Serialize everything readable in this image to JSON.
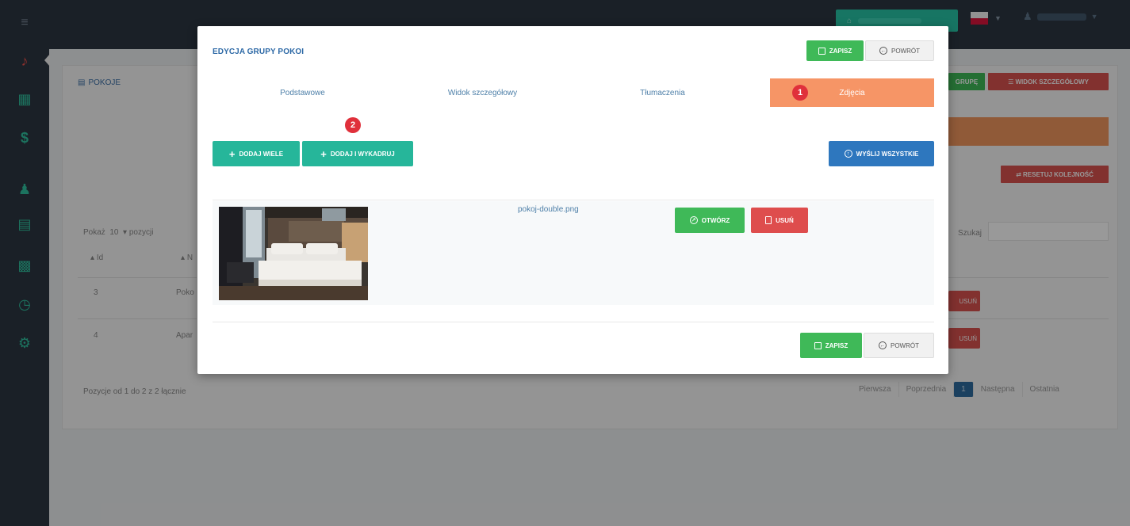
{
  "background": {
    "section_title": "POKOJE",
    "btn_group_suffix": "GRUPĘ",
    "btn_detail_view": "WIDOK SZCZEGÓŁOWY",
    "btn_reset_order": "RESETUJ KOLEJNOŚĆ",
    "show_prefix": "Pokaż",
    "show_count": "10",
    "show_suffix": "pozycji",
    "search_label": "Szukaj",
    "col_id": "Id",
    "col_name_fragment": "N",
    "rows": [
      {
        "id": "3",
        "name_fragment": "Poko",
        "delete_label": "USUŃ"
      },
      {
        "id": "4",
        "name_fragment": "Apar",
        "delete_label": "USUŃ"
      }
    ],
    "info_text": "Pozycje od 1 do 2 z 2 łącznie",
    "pager": {
      "first": "Pierwsza",
      "prev": "Poprzednia",
      "current": "1",
      "next": "Następna",
      "last": "Ostatnia"
    }
  },
  "modal": {
    "title": "EDYCJA GRUPY POKOI",
    "save_label": "ZAPISZ",
    "back_label": "POWRÓT",
    "tabs": [
      {
        "label": "Podstawowe"
      },
      {
        "label": "Widok szczegółowy"
      },
      {
        "label": "Tłumaczenia"
      },
      {
        "label": "Zdjęcia",
        "badge": "1"
      }
    ],
    "add_many_label": "DODAJ WIELE",
    "add_crop_label": "DODAJ I WYKADRUJ",
    "add_crop_badge": "2",
    "send_all_label": "WYŚLIJ WSZYSTKIE",
    "file": {
      "name": "pokoj-double.png",
      "open_label": "OTWÓRZ",
      "delete_label": "USUŃ"
    }
  },
  "colors": {
    "active_tab": "#f69566",
    "badge": "#e0303b",
    "save": "#3fb958",
    "add": "#26b69a",
    "send": "#2e77be",
    "delete": "#de4d4d"
  }
}
